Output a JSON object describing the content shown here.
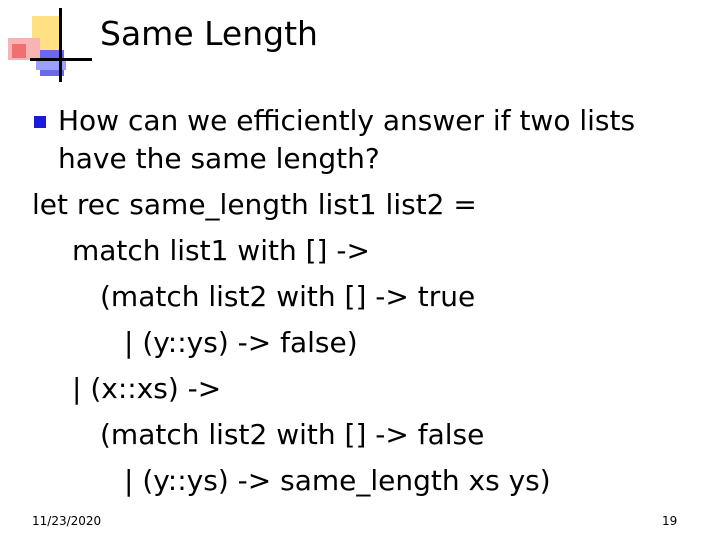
{
  "slide": {
    "title": "Same Length",
    "lines": [
      "How can we efficiently answer if two lists",
      "have the same length?",
      "let rec same_length list1 list2 =",
      "match list1 with [] ->",
      "(match list2 with [] -> true",
      "| (y::ys) -> false)",
      "| (x::xs) ->",
      "(match list2 with [] -> false",
      "| (y::ys) -> same_length xs ys)"
    ],
    "bullet_icon": "square-bullet-icon",
    "accent_color": "#1a1ad8"
  },
  "footer": {
    "date": "11/23/2020",
    "page": "19"
  }
}
